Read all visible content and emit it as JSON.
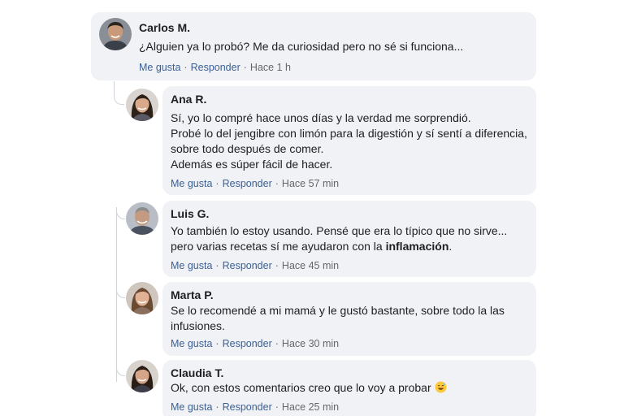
{
  "comments": [
    {
      "name": "Carlos M.",
      "lines": [
        "¿Alguien ya lo probó? Me da curiosidad pero no sé si funciona..."
      ],
      "time": "Hace 1 h"
    },
    {
      "name": "Ana R.",
      "lines": [
        "Sí, yo lo compré hace unos días y la verdad me sorprendió.",
        "Probé lo del jengibre con limón para la digestión y sí sentí a diferencia,",
        "sobre todo después de comer.",
        "Además es súper fácil de hacer."
      ],
      "time": "Hace 57 min"
    },
    {
      "name": "Luis G.",
      "lines": [
        "Yo también lo estoy usando. Pensé que era lo típico que no sirve...",
        "pero varias recetas sí me ayudaron con la "
      ],
      "bold_word": "inflamación",
      "bold_suffix": ".",
      "time": "Hace 45 min"
    },
    {
      "name": "Marta P.",
      "lines": [
        "Se lo recomendé a mi mamá y le gustó bastante, sobre todo la las",
        "infusiones."
      ],
      "time": "Hace 30 min"
    },
    {
      "name": "Claudia T.",
      "lines": [
        "Ok, con estos comentarios creo que lo voy a probar"
      ],
      "emoji": "grinning-sweat-emoji",
      "time": "Hace 25 min"
    }
  ],
  "actions": {
    "like": "Me gusta",
    "reply": "Responder",
    "separator": "·"
  },
  "colors": {
    "bubble": "#f0f2f5",
    "link": "#3b5f96",
    "muted": "#65676b",
    "thread_line": "#cfd3da"
  }
}
